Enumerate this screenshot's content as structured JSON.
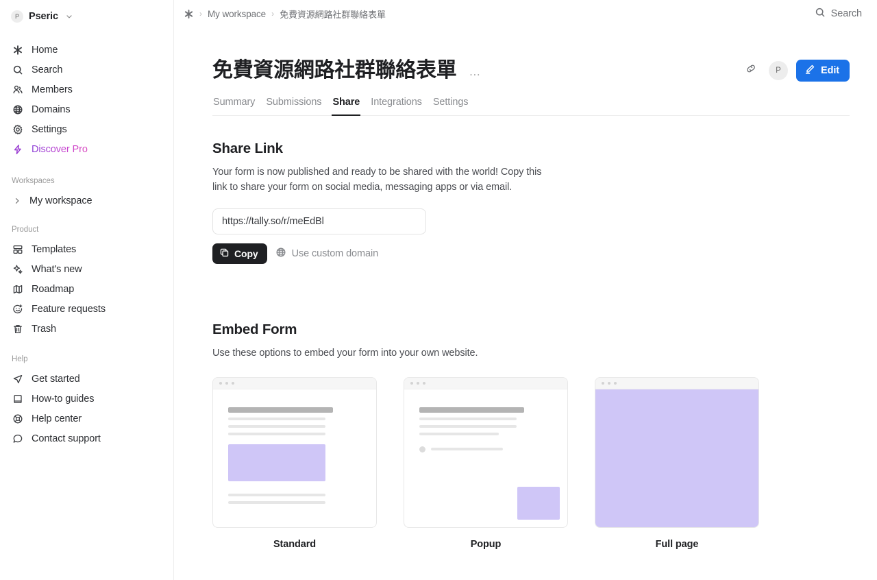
{
  "sidebar": {
    "workspace_switcher": {
      "avatar": "P",
      "name": "Pseric",
      "icon": "chevron-down-icon"
    },
    "primary_items": [
      {
        "label": "Home",
        "icon": "asterisk-icon"
      },
      {
        "label": "Search",
        "icon": "search-icon"
      },
      {
        "label": "Members",
        "icon": "members-icon"
      },
      {
        "label": "Domains",
        "icon": "globe-icon"
      },
      {
        "label": "Settings",
        "icon": "gear-icon"
      },
      {
        "label": "Discover Pro",
        "icon": "lightning-icon"
      }
    ],
    "workspaces_label": "Workspaces",
    "workspaces": [
      {
        "label": "My workspace",
        "icon": "chevron-right-icon"
      }
    ],
    "product_label": "Product",
    "product_items": [
      {
        "label": "Templates",
        "icon": "templates-icon"
      },
      {
        "label": "What's new",
        "icon": "sparkles-icon"
      },
      {
        "label": "Roadmap",
        "icon": "map-icon"
      },
      {
        "label": "Feature requests",
        "icon": "smiley-plus-icon"
      },
      {
        "label": "Trash",
        "icon": "trash-icon"
      }
    ],
    "help_label": "Help",
    "help_items": [
      {
        "label": "Get started",
        "icon": "paper-plane-icon"
      },
      {
        "label": "How-to guides",
        "icon": "book-icon"
      },
      {
        "label": "Help center",
        "icon": "lifebuoy-icon"
      },
      {
        "label": "Contact support",
        "icon": "chat-bubble-icon"
      }
    ]
  },
  "topbar": {
    "home_icon": "asterisk-icon",
    "separator": "›",
    "breadcrumbs": [
      "My workspace",
      "免費資源網路社群聯絡表單"
    ],
    "search_label": "Search",
    "search_icon": "search-icon"
  },
  "header": {
    "title": "免費資源網路社群聯絡表單",
    "more_menu": "…",
    "link_icon": "link-icon",
    "avatar": "P",
    "edit_label": "Edit",
    "edit_icon": "pencil-icon"
  },
  "tabs": [
    {
      "label": "Summary",
      "active": false
    },
    {
      "label": "Submissions",
      "active": false
    },
    {
      "label": "Share",
      "active": true
    },
    {
      "label": "Integrations",
      "active": false
    },
    {
      "label": "Settings",
      "active": false
    }
  ],
  "share_link": {
    "title": "Share Link",
    "description": "Your form is now published and ready to be shared with the world! Copy this link to share your form on social media, messaging apps or via email.",
    "url_value": "https://tally.so/r/meEdBl",
    "url_placeholder": "https://tally.so/r/",
    "copy_label": "Copy",
    "copy_icon": "copy-icon",
    "custom_domain_label": "Use custom domain",
    "custom_domain_icon": "globe-icon"
  },
  "embed_form": {
    "title": "Embed Form",
    "description": "Use these options to embed your form into your own website.",
    "options": [
      {
        "label": "Standard"
      },
      {
        "label": "Popup"
      },
      {
        "label": "Full page"
      }
    ]
  },
  "colors": {
    "accent_blue": "#1b72e8",
    "embed_purple": "#cfc6f7",
    "pro_purple": "#b340cf",
    "dark_button": "#1f2023",
    "border": "#ededed"
  }
}
